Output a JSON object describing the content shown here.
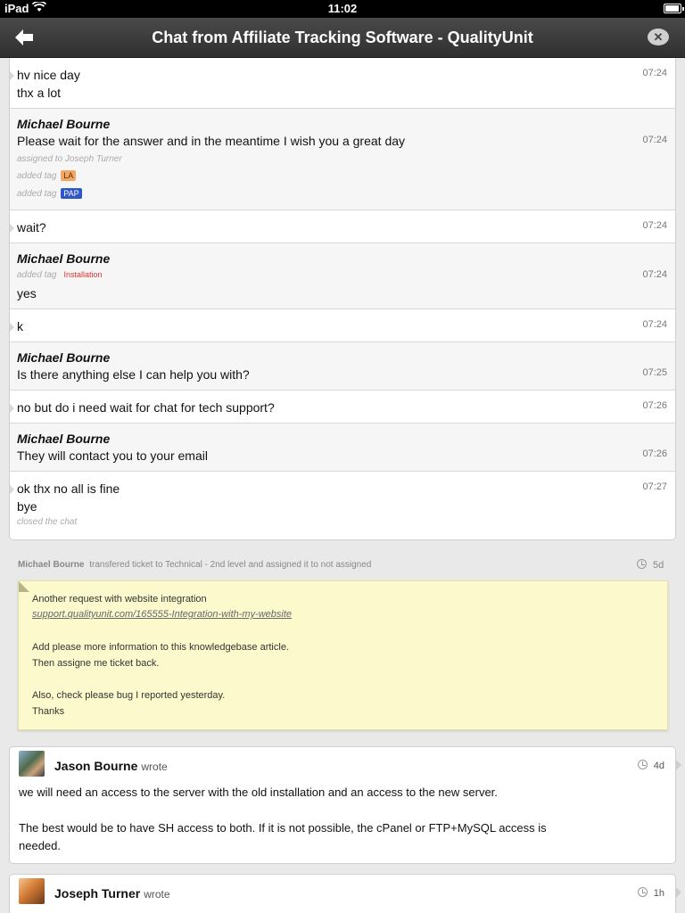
{
  "status_bar": {
    "carrier": "iPad",
    "time": "11:02"
  },
  "nav": {
    "title": "Chat from Affiliate Tracking Software - QualityUnit",
    "back_icon": "back-arrow-icon",
    "close_icon": "close-bubble-icon"
  },
  "chat": {
    "messages": [
      {
        "lines": [
          "hv nice day",
          "thx a lot"
        ],
        "time": "07:24"
      },
      {
        "author": "Michael Bourne",
        "lines": [
          "Please wait for the answer and in the meantime I wish you a great day"
        ],
        "time": "07:24",
        "meta": [
          "assigned to Joseph Turner",
          "added tag",
          "added tag"
        ],
        "tags": [
          "LA",
          "PAP"
        ]
      },
      {
        "lines": [
          "wait?"
        ],
        "time": "07:24"
      },
      {
        "author": "Michael Bourne",
        "meta": [
          "added tag"
        ],
        "tags": [
          "Installation"
        ],
        "lines": [
          "yes"
        ],
        "time": "07:24"
      },
      {
        "lines": [
          "k"
        ],
        "time": "07:24"
      },
      {
        "author": "Michael Bourne",
        "lines": [
          "Is there anything else I can help you with?"
        ],
        "time": "07:25"
      },
      {
        "lines": [
          "no but do i need wait for chat for tech support?"
        ],
        "time": "07:26"
      },
      {
        "author": "Michael Bourne",
        "lines": [
          "They will contact you to your email"
        ],
        "time": "07:26"
      },
      {
        "lines": [
          "ok thx no all is fine",
          "bye"
        ],
        "time": "07:27",
        "meta": [
          "closed the chat"
        ]
      }
    ]
  },
  "transfer": {
    "author": "Michael Bourne",
    "text": "transfered ticket to Technical - 2nd level and assigned it to not assigned",
    "time": "5d"
  },
  "note": {
    "lines": [
      "Another request with website integration",
      "support.qualityunit.com/165555-Integration-with-my-website",
      "Add please more information to this knowledgebase article.",
      "Then assigne me ticket back.",
      "Also, check please bug I reported yesterday.",
      "Thanks"
    ]
  },
  "replies": [
    {
      "name": "Jason Bourne",
      "wrote": "wrote",
      "time": "4d",
      "lines": [
        "we will need an access to the server with the old installation and an access to the new server.",
        "The best would be to have SH access to both. If it is not possible, the cPanel or FTP+MySQL access is",
        "needed."
      ]
    },
    {
      "name": "Joseph Turner",
      "wrote": "wrote",
      "time": "1h"
    }
  ]
}
